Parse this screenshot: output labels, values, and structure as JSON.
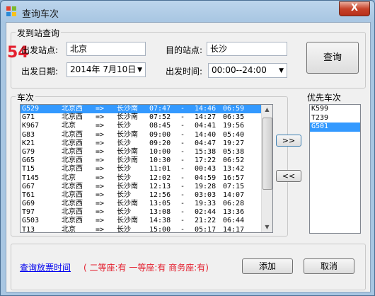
{
  "window": {
    "title": "查询车次",
    "close_label": "X"
  },
  "search": {
    "group_label": "发到站查询",
    "badge": "54",
    "from_label": "出发站点:",
    "from_value": "北京",
    "to_label": "目的站点:",
    "to_value": "长沙",
    "date_label": "出发日期:",
    "date_value": "2014年  7月10日",
    "time_label": "出发时间:",
    "time_value": "00:00--24:00",
    "query_button": "查询"
  },
  "trains": {
    "group_label": "车次",
    "rows": [
      {
        "no": "G529",
        "from": "北京西",
        "arrow": "=>",
        "to": "长沙南",
        "dep": "07:47",
        "dash": "-",
        "arr": "14:46",
        "dur": "06:59",
        "selected": true
      },
      {
        "no": "G71",
        "from": "北京西",
        "arrow": "=>",
        "to": "长沙南",
        "dep": "07:52",
        "dash": "-",
        "arr": "14:27",
        "dur": "06:35",
        "selected": false
      },
      {
        "no": "K967",
        "from": "北京",
        "arrow": "=>",
        "to": "长沙",
        "dep": "08:45",
        "dash": "-",
        "arr": "04:41",
        "dur": "19:56",
        "selected": false
      },
      {
        "no": "G83",
        "from": "北京西",
        "arrow": "=>",
        "to": "长沙南",
        "dep": "09:00",
        "dash": "-",
        "arr": "14:40",
        "dur": "05:40",
        "selected": false
      },
      {
        "no": "K21",
        "from": "北京西",
        "arrow": "=>",
        "to": "长沙",
        "dep": "09:20",
        "dash": "-",
        "arr": "04:47",
        "dur": "19:27",
        "selected": false
      },
      {
        "no": "G79",
        "from": "北京西",
        "arrow": "=>",
        "to": "长沙南",
        "dep": "10:00",
        "dash": "-",
        "arr": "15:38",
        "dur": "05:38",
        "selected": false
      },
      {
        "no": "G65",
        "from": "北京西",
        "arrow": "=>",
        "to": "长沙南",
        "dep": "10:30",
        "dash": "-",
        "arr": "17:22",
        "dur": "06:52",
        "selected": false
      },
      {
        "no": "T15",
        "from": "北京西",
        "arrow": "=>",
        "to": "长沙",
        "dep": "11:01",
        "dash": "-",
        "arr": "00:43",
        "dur": "13:42",
        "selected": false
      },
      {
        "no": "T145",
        "from": "北京",
        "arrow": "=>",
        "to": "长沙",
        "dep": "12:02",
        "dash": "-",
        "arr": "04:59",
        "dur": "16:57",
        "selected": false
      },
      {
        "no": "G67",
        "from": "北京西",
        "arrow": "=>",
        "to": "长沙南",
        "dep": "12:13",
        "dash": "-",
        "arr": "19:28",
        "dur": "07:15",
        "selected": false
      },
      {
        "no": "T61",
        "from": "北京西",
        "arrow": "=>",
        "to": "长沙",
        "dep": "12:56",
        "dash": "-",
        "arr": "03:03",
        "dur": "14:07",
        "selected": false
      },
      {
        "no": "G69",
        "from": "北京西",
        "arrow": "=>",
        "to": "长沙南",
        "dep": "13:05",
        "dash": "-",
        "arr": "19:33",
        "dur": "06:28",
        "selected": false
      },
      {
        "no": "T97",
        "from": "北京西",
        "arrow": "=>",
        "to": "长沙",
        "dep": "13:08",
        "dash": "-",
        "arr": "02:44",
        "dur": "13:36",
        "selected": false
      },
      {
        "no": "G503",
        "from": "北京西",
        "arrow": "=>",
        "to": "长沙南",
        "dep": "14:38",
        "dash": "-",
        "arr": "21:22",
        "dur": "06:44",
        "selected": false
      },
      {
        "no": "T13",
        "from": "北京",
        "arrow": "=>",
        "to": "长沙",
        "dep": "15:00",
        "dash": "-",
        "arr": "05:17",
        "dur": "14:17",
        "selected": false
      }
    ]
  },
  "transfer": {
    "add_arrow": ">>",
    "remove_arrow": "<<"
  },
  "priority": {
    "group_label": "优先车次",
    "items": [
      {
        "label": "K599",
        "selected": false
      },
      {
        "label": "T239",
        "selected": false
      },
      {
        "label": "G501",
        "selected": true
      }
    ]
  },
  "bottom": {
    "link": "查询放票时间",
    "seats": "( 二等座:有 一等座:有 商务座:有)",
    "add_button": "添加",
    "cancel_button": "取消"
  },
  "colors": {
    "selection": "#3399ff",
    "accent_red": "#e4202f",
    "link": "#0000ee"
  }
}
